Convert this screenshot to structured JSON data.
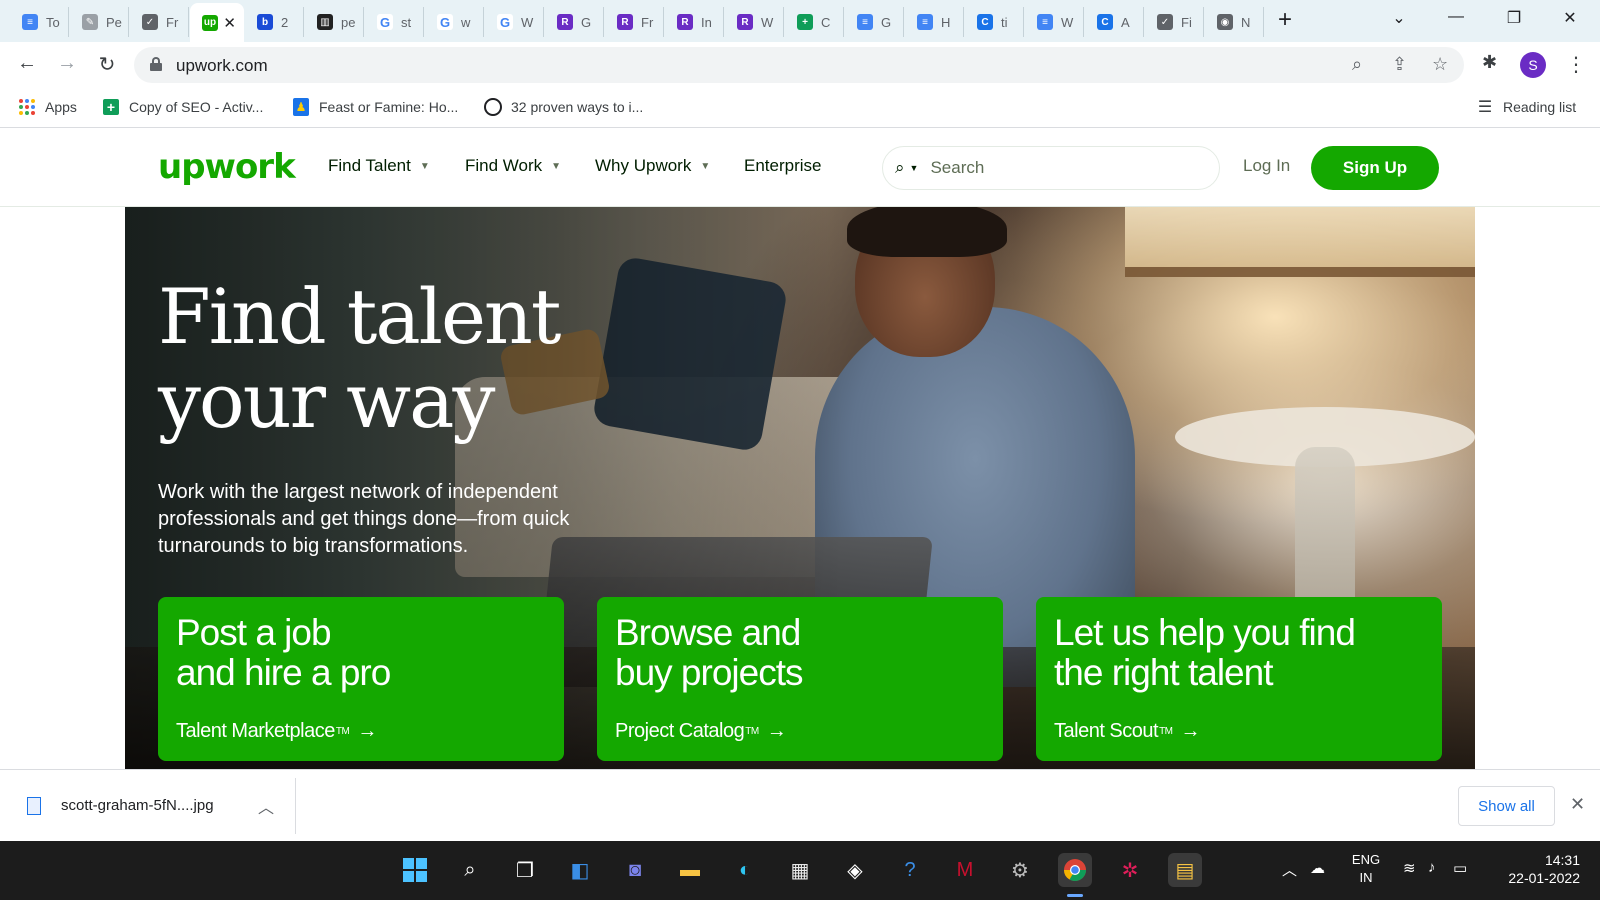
{
  "browser": {
    "tabs": [
      {
        "label": "To",
        "icon": "docs-icon",
        "color": "#4285f4",
        "glyph": "≡"
      },
      {
        "label": "Pe",
        "icon": "quill-icon",
        "color": "#9aa0a6",
        "glyph": "✎"
      },
      {
        "label": "Fr",
        "icon": "form-icon",
        "color": "#5f6368",
        "glyph": "✓"
      },
      {
        "label": "",
        "icon": "upwork-icon",
        "color": "#14a800",
        "glyph": "up",
        "active": true
      },
      {
        "label": "2",
        "icon": "b-icon",
        "color": "#1a4bd6",
        "glyph": "b"
      },
      {
        "label": "pe",
        "icon": "wordpress-icon",
        "color": "#222222",
        "glyph": "▥"
      },
      {
        "label": "st",
        "icon": "google-icon",
        "color": "#ffffff",
        "glyph": "G"
      },
      {
        "label": "w",
        "icon": "google-icon",
        "color": "#ffffff",
        "glyph": "G"
      },
      {
        "label": "W",
        "icon": "google-icon",
        "color": "#ffffff",
        "glyph": "G"
      },
      {
        "label": "G",
        "icon": "r-icon",
        "color": "#6a2cc4",
        "glyph": "R"
      },
      {
        "label": "Fr",
        "icon": "r-icon",
        "color": "#6a2cc4",
        "glyph": "R"
      },
      {
        "label": "In",
        "icon": "r-icon",
        "color": "#6a2cc4",
        "glyph": "R"
      },
      {
        "label": "W",
        "icon": "r-icon",
        "color": "#6a2cc4",
        "glyph": "R"
      },
      {
        "label": "C",
        "icon": "sheets-icon",
        "color": "#0f9d58",
        "glyph": "+"
      },
      {
        "label": "G",
        "icon": "docs-icon",
        "color": "#4285f4",
        "glyph": "≡"
      },
      {
        "label": "H",
        "icon": "docs-icon",
        "color": "#4285f4",
        "glyph": "≡"
      },
      {
        "label": "ti",
        "icon": "c-icon",
        "color": "#1a73e8",
        "glyph": "C"
      },
      {
        "label": "W",
        "icon": "docs-icon",
        "color": "#4285f4",
        "glyph": "≡"
      },
      {
        "label": "A",
        "icon": "c-icon",
        "color": "#1a73e8",
        "glyph": "C"
      },
      {
        "label": "Fi",
        "icon": "form-icon",
        "color": "#5f6368",
        "glyph": "✓"
      },
      {
        "label": "N",
        "icon": "chrome-icon",
        "color": "#5f6368",
        "glyph": "◉"
      }
    ],
    "url": "upwork.com",
    "bookmarks": [
      {
        "label": "Apps",
        "icon": "apps-grid-icon"
      },
      {
        "label": "Copy of SEO - Activ...",
        "icon": "sheets-icon"
      },
      {
        "label": "Feast or Famine: Ho...",
        "icon": "person-icon"
      },
      {
        "label": "32 proven ways to i...",
        "icon": "circle-icon"
      }
    ],
    "reading_list": "Reading list",
    "profile_initial": "S"
  },
  "site": {
    "logo": "upwork",
    "nav": [
      {
        "label": "Find Talent",
        "has_caret": true
      },
      {
        "label": "Find Work",
        "has_caret": true
      },
      {
        "label": "Why Upwork",
        "has_caret": true
      },
      {
        "label": "Enterprise",
        "has_caret": false
      }
    ],
    "search_placeholder": "Search",
    "login": "Log In",
    "signup": "Sign Up",
    "hero": {
      "title_line1": "Find talent",
      "title_line2": "your way",
      "subtitle": "Work with the largest network of independent professionals and get things done—from quick turnarounds to big transformations."
    },
    "cards": [
      {
        "line1": "Post a job",
        "line2": "and hire a pro",
        "link": "Talent Marketplace",
        "tm": "TM"
      },
      {
        "line1": "Browse and",
        "line2": "buy projects",
        "link": "Project Catalog",
        "tm": "TM"
      },
      {
        "line1": "Let us help you find",
        "line2": "the right talent",
        "link": "Talent Scout",
        "tm": "TM"
      }
    ],
    "accent": "#14a800"
  },
  "downloads": {
    "file": "scott-graham-5fN....jpg",
    "show_all": "Show all"
  },
  "taskbar": {
    "lang_line1": "ENG",
    "lang_line2": "IN",
    "time": "14:31",
    "date": "22-01-2022"
  }
}
